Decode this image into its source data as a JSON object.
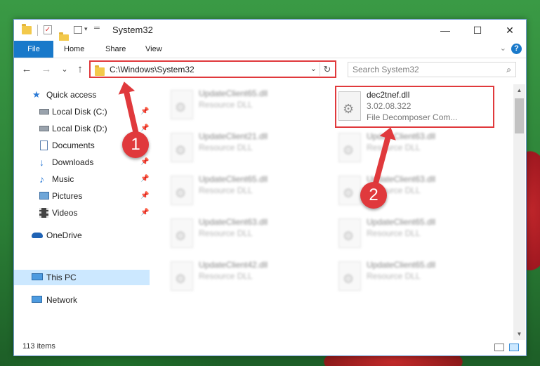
{
  "window": {
    "title": "System32",
    "minimize_icon": "—",
    "maximize_icon": "☐",
    "close_icon": "✕"
  },
  "ribbon": {
    "tabs": [
      "File",
      "Home",
      "Share",
      "View"
    ],
    "help_glyph": "?",
    "collapse_glyph": "⌄"
  },
  "navigation": {
    "back_glyph": "←",
    "forward_glyph": "→",
    "recent_glyph": "⌄",
    "up_glyph": "↑",
    "address": "C:\\Windows\\System32",
    "address_dropdown_glyph": "⌄",
    "refresh_glyph": "↻",
    "search_placeholder": "Search System32",
    "search_glyph": "⌕"
  },
  "sidebar": {
    "items": [
      {
        "label": "Quick access",
        "icon": "star-icon",
        "pinned": false
      },
      {
        "label": "Local Disk (C:)",
        "icon": "drive-icon",
        "pinned": true
      },
      {
        "label": "Local Disk (D:)",
        "icon": "drive-icon",
        "pinned": true
      },
      {
        "label": "Documents",
        "icon": "documents-icon",
        "pinned": true
      },
      {
        "label": "Downloads",
        "icon": "download-icon",
        "pinned": true
      },
      {
        "label": "Music",
        "icon": "music-icon",
        "pinned": true
      },
      {
        "label": "Pictures",
        "icon": "pictures-icon",
        "pinned": true
      },
      {
        "label": "Videos",
        "icon": "videos-icon",
        "pinned": true
      },
      {
        "label": "OneDrive",
        "icon": "cloud-icon",
        "pinned": false
      },
      {
        "label": "This PC",
        "icon": "computer-icon",
        "pinned": false,
        "selected": true
      },
      {
        "label": "Network",
        "icon": "network-icon",
        "pinned": false
      }
    ],
    "pin_glyph": "📌"
  },
  "files": [
    {
      "name": "UpdateClient65.dll",
      "type": "Resource DLL",
      "blurred": true
    },
    {
      "name": "dec2tnef.dll",
      "version": "3.02.08.322",
      "description": "File Decomposer Com...",
      "blurred": false
    },
    {
      "name": "UpdateClient21.dll",
      "type": "Resource DLL",
      "blurred": true
    },
    {
      "name": "UpdateClient63.dll",
      "type": "Resource DLL",
      "blurred": true
    },
    {
      "name": "UpdateClient65.dll",
      "type": "Resource DLL",
      "blurred": true
    },
    {
      "name": "UpdateClient63.dll",
      "type": "Resource DLL",
      "blurred": true
    },
    {
      "name": "UpdateClient63.dll",
      "type": "Resource DLL",
      "blurred": true
    },
    {
      "name": "UpdateClient65.dll",
      "type": "Resource DLL",
      "blurred": true
    },
    {
      "name": "UpdateClient42.dll",
      "type": "Resource DLL",
      "blurred": true
    },
    {
      "name": "UpdateClient65.dll",
      "type": "Resource DLL",
      "blurred": true
    }
  ],
  "status": {
    "item_count": "113 items"
  },
  "annotations": {
    "badge_1": "1",
    "badge_2": "2",
    "accent_color": "#e0393c"
  },
  "colors": {
    "selection": "#cce8ff",
    "file_tab": "#1979ca"
  }
}
